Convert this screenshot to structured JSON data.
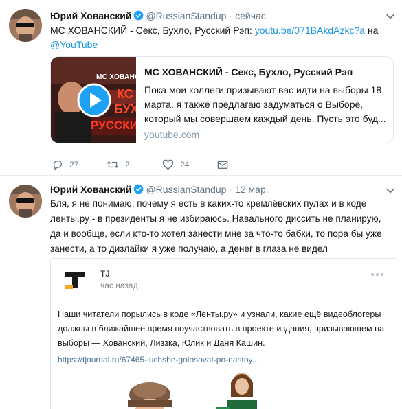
{
  "tweets": [
    {
      "author_name": "Юрий Хованский",
      "handle": "@RussianStandup",
      "separator": "·",
      "time": "сейчас",
      "text_main": "МС ХОВАНСКИЙ - Секс, Бухло, Русский Рэп: ",
      "text_link": "youtu.be/071BAkdAzkc?a",
      "text_after": " на",
      "text_mention": "@YouTube",
      "card": {
        "title": "МС ХОВАНСКИЙ - Секс, Бухло, Русский Рэп",
        "description": "Пока мои коллеги призывают вас идти на выборы 18 марта, я также предлагаю задуматься о Выборе, который мы совершаем каждый день. Пусть это буд...",
        "domain": "youtube.com",
        "thumb_caption": "МС ХОВАНСКИЙ",
        "thumb_caption2": "КС",
        "thumb_caption3": "БУХ",
        "thumb_caption4": "РУССКИЙ Р"
      },
      "actions": {
        "replies": "27",
        "retweets": "2",
        "likes": "24"
      }
    },
    {
      "author_name": "Юрий Хованский",
      "handle": "@RussianStandup",
      "separator": "·",
      "time": "12 мар.",
      "text_line1": "Бля, я не понимаю, почему я есть в каких-то кремлёвских пулах и в коде",
      "text_line2": "ленты.ру - в президенты я не избираюсь. Навального диссить не планирую,",
      "text_line3": "да и вообще, если кто-то хотел занести мне за что-то бабки, то пора бы уже",
      "text_line4": "занести, а то дизлайки я уже получаю, а денег в глаза не видел",
      "embed": {
        "source_name": "TJ",
        "source_time": "час назад",
        "text_line1": "Наши читатели порылись в коде «Ленты.ру» и узнали, какие ещё видеоблогеры",
        "text_line2": "должны в ближайшее время поучаствовать в проекте издания, призывающем на",
        "text_line3": "выборы — Хованский, Лиззка, Юлик и Даня Кашин.",
        "url": "https://tjournal.ru/67465-luchshe-golosovat-po-nastoy..."
      }
    }
  ],
  "colors": {
    "link": "#1b95e0",
    "verified": "#1da1f2",
    "secondary": "#657786",
    "border": "#e1e8ed"
  },
  "icons": {
    "verified": "verified-badge-icon",
    "caret": "chevron-down-icon",
    "reply": "reply-icon",
    "retweet": "retweet-icon",
    "like": "heart-icon",
    "dm": "envelope-icon",
    "play": "play-icon",
    "more": "more-dots-icon"
  }
}
